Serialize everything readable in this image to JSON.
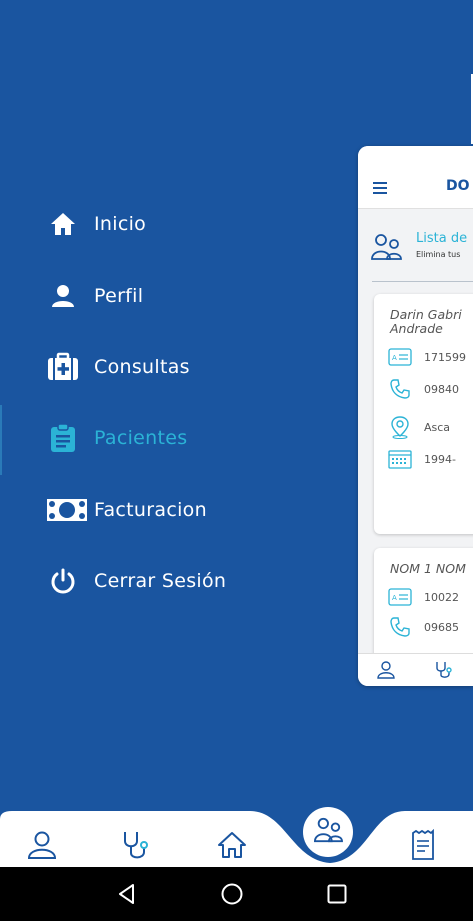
{
  "menu": {
    "items": [
      {
        "label": "Inicio",
        "icon": "home-icon"
      },
      {
        "label": "Perfil",
        "icon": "person-icon"
      },
      {
        "label": "Consultas",
        "icon": "medical-kit-icon"
      },
      {
        "label": "Pacientes",
        "icon": "clipboard-icon",
        "active": true
      },
      {
        "label": "Facturacion",
        "icon": "money-icon"
      },
      {
        "label": "Cerrar Sesión",
        "icon": "power-icon"
      }
    ]
  },
  "preview": {
    "brand": "DO",
    "list_title": "Lista de",
    "list_subtitle": "Elimina tus",
    "patients": [
      {
        "name_line1": "Darin Gabri",
        "name_line2": "Andrade",
        "id": "171599",
        "phone": "09840",
        "address": "Asca",
        "birth": "1994-"
      },
      {
        "name_line1": "NOM 1 NOM",
        "id": "10022",
        "phone": "09685"
      }
    ]
  },
  "colors": {
    "background": "#1a55a0",
    "accent": "#2bb3d6",
    "white": "#ffffff"
  }
}
